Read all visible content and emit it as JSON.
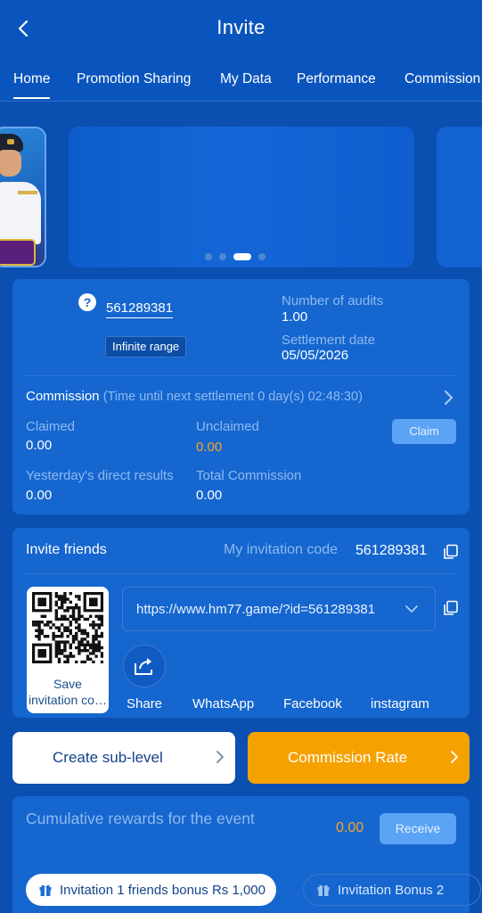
{
  "header": {
    "title": "Invite"
  },
  "tabs": [
    {
      "label": "Home",
      "active": true
    },
    {
      "label": "Promotion Sharing"
    },
    {
      "label": "My Data"
    },
    {
      "label": "Performance"
    },
    {
      "label": "Commission"
    }
  ],
  "banner": {
    "slide_count": 4,
    "active_slide": 3
  },
  "account": {
    "uid": "561289381",
    "range_badge": "Infinite range",
    "audits_label": "Number of audits",
    "audits_value": "1.00",
    "settlement_label": "Settlement date",
    "settlement_value": "05/05/2026"
  },
  "commission": {
    "title": "Commission",
    "timer": "(Time until next settlement 0 day(s) 02:48:30)",
    "claimed_label": "Claimed",
    "claimed_value": "0.00",
    "unclaimed_label": "Unclaimed",
    "unclaimed_value": "0.00",
    "claim_button": "Claim",
    "yesterday_label": "Yesterday's direct results",
    "yesterday_value": "0.00",
    "total_label": "Total Commission",
    "total_value": "0.00"
  },
  "invite": {
    "title": "Invite friends",
    "code_label": "My invitation code",
    "code_value": "561289381",
    "link": "https://www.hm77.game/?id=561289381",
    "qr_label_line1": "Save",
    "qr_label_line2": "invitation code",
    "share_labels": [
      "Share",
      "WhatsApp",
      "Facebook",
      "instagram"
    ]
  },
  "actions": {
    "create_sub_level": "Create sub-level",
    "commission_rate": "Commission Rate"
  },
  "rewards": {
    "label": "Cumulative rewards for the event",
    "value": "0.00",
    "receive_button": "Receive",
    "bonus_tabs": [
      "Invitation 1 friends bonus Rs 1,000",
      "Invitation Bonus 2"
    ]
  },
  "colors": {
    "background": "#0b4fb0",
    "card": "#1566cf",
    "accent_orange": "#f5a100",
    "muted_text": "#8fbaf0",
    "button_blue": "#5aa3f5"
  }
}
